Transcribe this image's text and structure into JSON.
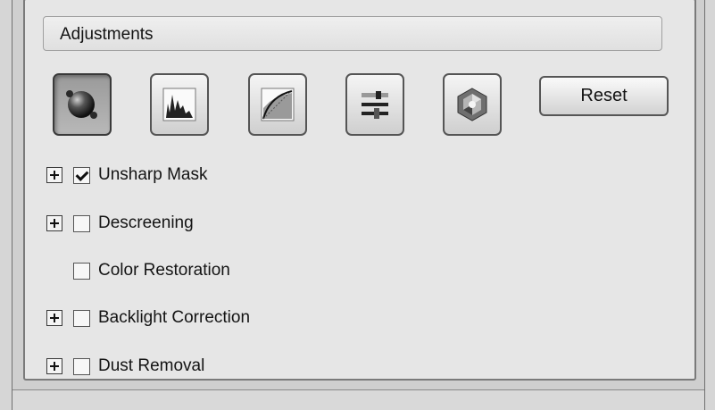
{
  "section": {
    "title": "Adjustments"
  },
  "toolbar": {
    "buttons": [
      {
        "icon": "auto-exposure-icon",
        "active": true
      },
      {
        "icon": "histogram-icon",
        "active": false
      },
      {
        "icon": "tone-curve-icon",
        "active": false
      },
      {
        "icon": "image-adjustment-sliders-icon",
        "active": false
      },
      {
        "icon": "color-palette-icon",
        "active": false
      }
    ],
    "reset_label": "Reset"
  },
  "options": [
    {
      "label": "Unsharp Mask",
      "expandable": true,
      "checked": true
    },
    {
      "label": "Descreening",
      "expandable": true,
      "checked": false
    },
    {
      "label": "Color Restoration",
      "expandable": false,
      "checked": false
    },
    {
      "label": "Backlight Correction",
      "expandable": true,
      "checked": false
    },
    {
      "label": "Dust Removal",
      "expandable": true,
      "checked": false
    }
  ]
}
